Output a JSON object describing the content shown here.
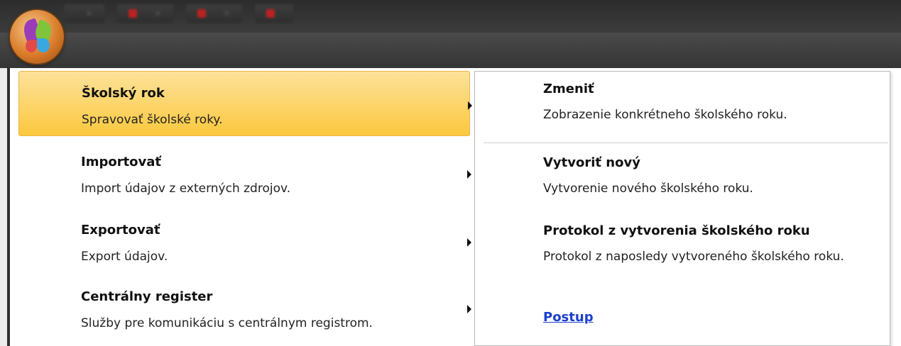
{
  "app": {
    "orb_icon": "butterfly-logo-icon",
    "accent_color": "#fbc83e"
  },
  "menu": {
    "items": [
      {
        "title": "Školský rok",
        "desc": "Spravovať školské roky.",
        "selected": true
      },
      {
        "title": "Importovať",
        "desc": "Import údajov z externých zdrojov.",
        "selected": false
      },
      {
        "title": "Exportovať",
        "desc": "Export údajov.",
        "selected": false
      },
      {
        "title": "Centrálny register",
        "desc": "Služby pre komunikáciu s centrálnym registrom.",
        "selected": false
      }
    ]
  },
  "submenu": {
    "items": [
      {
        "title": "Zmeniť",
        "desc": "Zobrazenie konkrétneho školského roku."
      },
      {
        "title": "Vytvoriť nový",
        "desc": "Vytvorenie nového školského roku."
      },
      {
        "title": "Protokol z vytvorenia školského roku",
        "desc": "Protokol z naposledy vytvoreného školského roku."
      }
    ],
    "link": "Postup",
    "link_color": "#1a3fcf"
  }
}
